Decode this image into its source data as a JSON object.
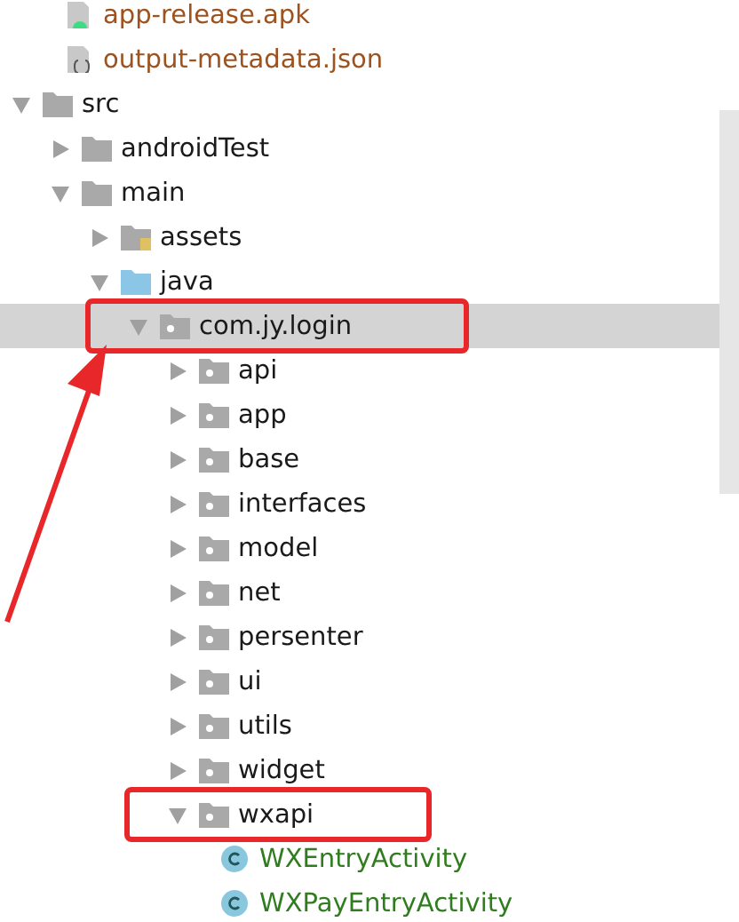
{
  "files_above": [
    {
      "label": "app-release.apk",
      "kind": "apk"
    },
    {
      "label": "output-metadata.json",
      "kind": "json"
    }
  ],
  "tree": [
    {
      "label": "src",
      "kind": "folder",
      "expanded": true,
      "selected": false,
      "annotated": false,
      "children": [
        {
          "label": "androidTest",
          "kind": "folder",
          "expanded": false,
          "selected": false,
          "annotated": false
        },
        {
          "label": "main",
          "kind": "folder",
          "expanded": true,
          "selected": false,
          "annotated": false,
          "children": [
            {
              "label": "assets",
              "kind": "resources",
              "expanded": false,
              "selected": false,
              "annotated": false
            },
            {
              "label": "java",
              "kind": "source",
              "expanded": true,
              "selected": false,
              "annotated": false,
              "children": [
                {
                  "label": "com.jy.login",
                  "kind": "package",
                  "expanded": true,
                  "selected": true,
                  "annotated": true,
                  "children": [
                    {
                      "label": "api",
                      "kind": "package",
                      "expanded": false,
                      "selected": false,
                      "annotated": false
                    },
                    {
                      "label": "app",
                      "kind": "package",
                      "expanded": false,
                      "selected": false,
                      "annotated": false
                    },
                    {
                      "label": "base",
                      "kind": "package",
                      "expanded": false,
                      "selected": false,
                      "annotated": false
                    },
                    {
                      "label": "interfaces",
                      "kind": "package",
                      "expanded": false,
                      "selected": false,
                      "annotated": false
                    },
                    {
                      "label": "model",
                      "kind": "package",
                      "expanded": false,
                      "selected": false,
                      "annotated": false
                    },
                    {
                      "label": "net",
                      "kind": "package",
                      "expanded": false,
                      "selected": false,
                      "annotated": false
                    },
                    {
                      "label": "persenter",
                      "kind": "package",
                      "expanded": false,
                      "selected": false,
                      "annotated": false
                    },
                    {
                      "label": "ui",
                      "kind": "package",
                      "expanded": false,
                      "selected": false,
                      "annotated": false
                    },
                    {
                      "label": "utils",
                      "kind": "package",
                      "expanded": false,
                      "selected": false,
                      "annotated": false
                    },
                    {
                      "label": "widget",
                      "kind": "package",
                      "expanded": false,
                      "selected": false,
                      "annotated": false
                    },
                    {
                      "label": "wxapi",
                      "kind": "package",
                      "expanded": true,
                      "selected": false,
                      "annotated": true,
                      "children": [
                        {
                          "label": "WXEntryActivity",
                          "kind": "class",
                          "selected": false,
                          "annotated": false
                        },
                        {
                          "label": "WXPayEntryActivity",
                          "kind": "class",
                          "selected": false,
                          "annotated": false
                        }
                      ]
                    }
                  ]
                }
              ]
            }
          ]
        }
      ]
    }
  ]
}
